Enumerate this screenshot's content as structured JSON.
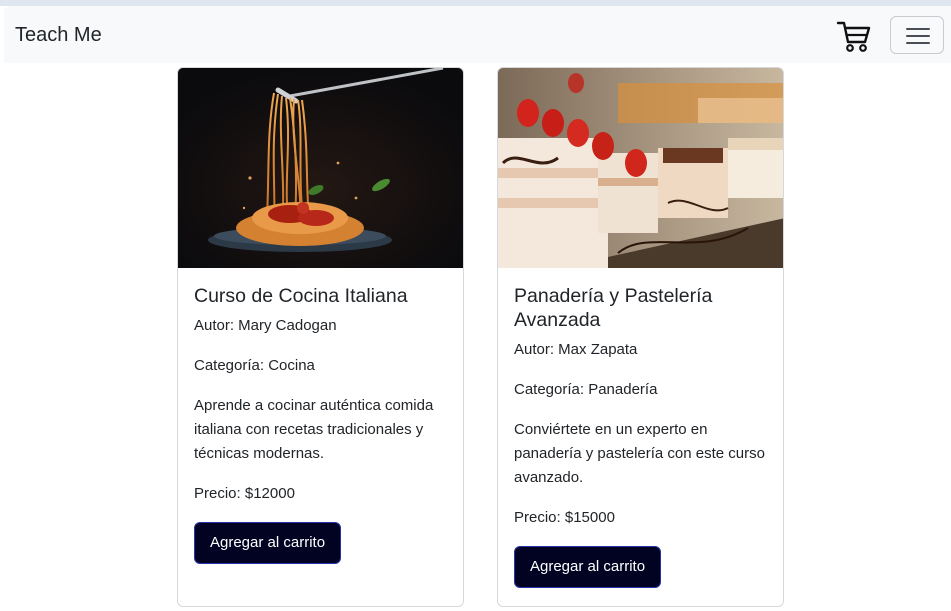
{
  "navbar": {
    "brand": "Teach Me",
    "cart_icon": "shopping-cart-icon",
    "menu_icon": "hamburger-menu-icon"
  },
  "courses": [
    {
      "image_alt": "spaghetti with tomato sauce lifted on a fork",
      "title": "Curso de Cocina Italiana",
      "author": "Autor: Mary Cadogan",
      "category": "Categoría: Cocina",
      "description": "Aprende a cocinar auténtica comida italiana con recetas tradicionales y técnicas modernas.",
      "price": "Precio: $12000",
      "button": "Agregar al carrito"
    },
    {
      "image_alt": "assorted pastries and cakes with strawberries",
      "title": "Panadería y Pastelería Avanzada",
      "author": "Autor: Max Zapata",
      "category": "Categoría: Panadería",
      "description": "Conviértete en un experto en panadería y pastelería con este curso avanzado.",
      "price": "Precio: $15000",
      "button": "Agregar al carrito"
    }
  ],
  "colors": {
    "navbar_bg": "#f8f9fa",
    "button_bg": "#020322",
    "button_border": "#2533a8"
  }
}
